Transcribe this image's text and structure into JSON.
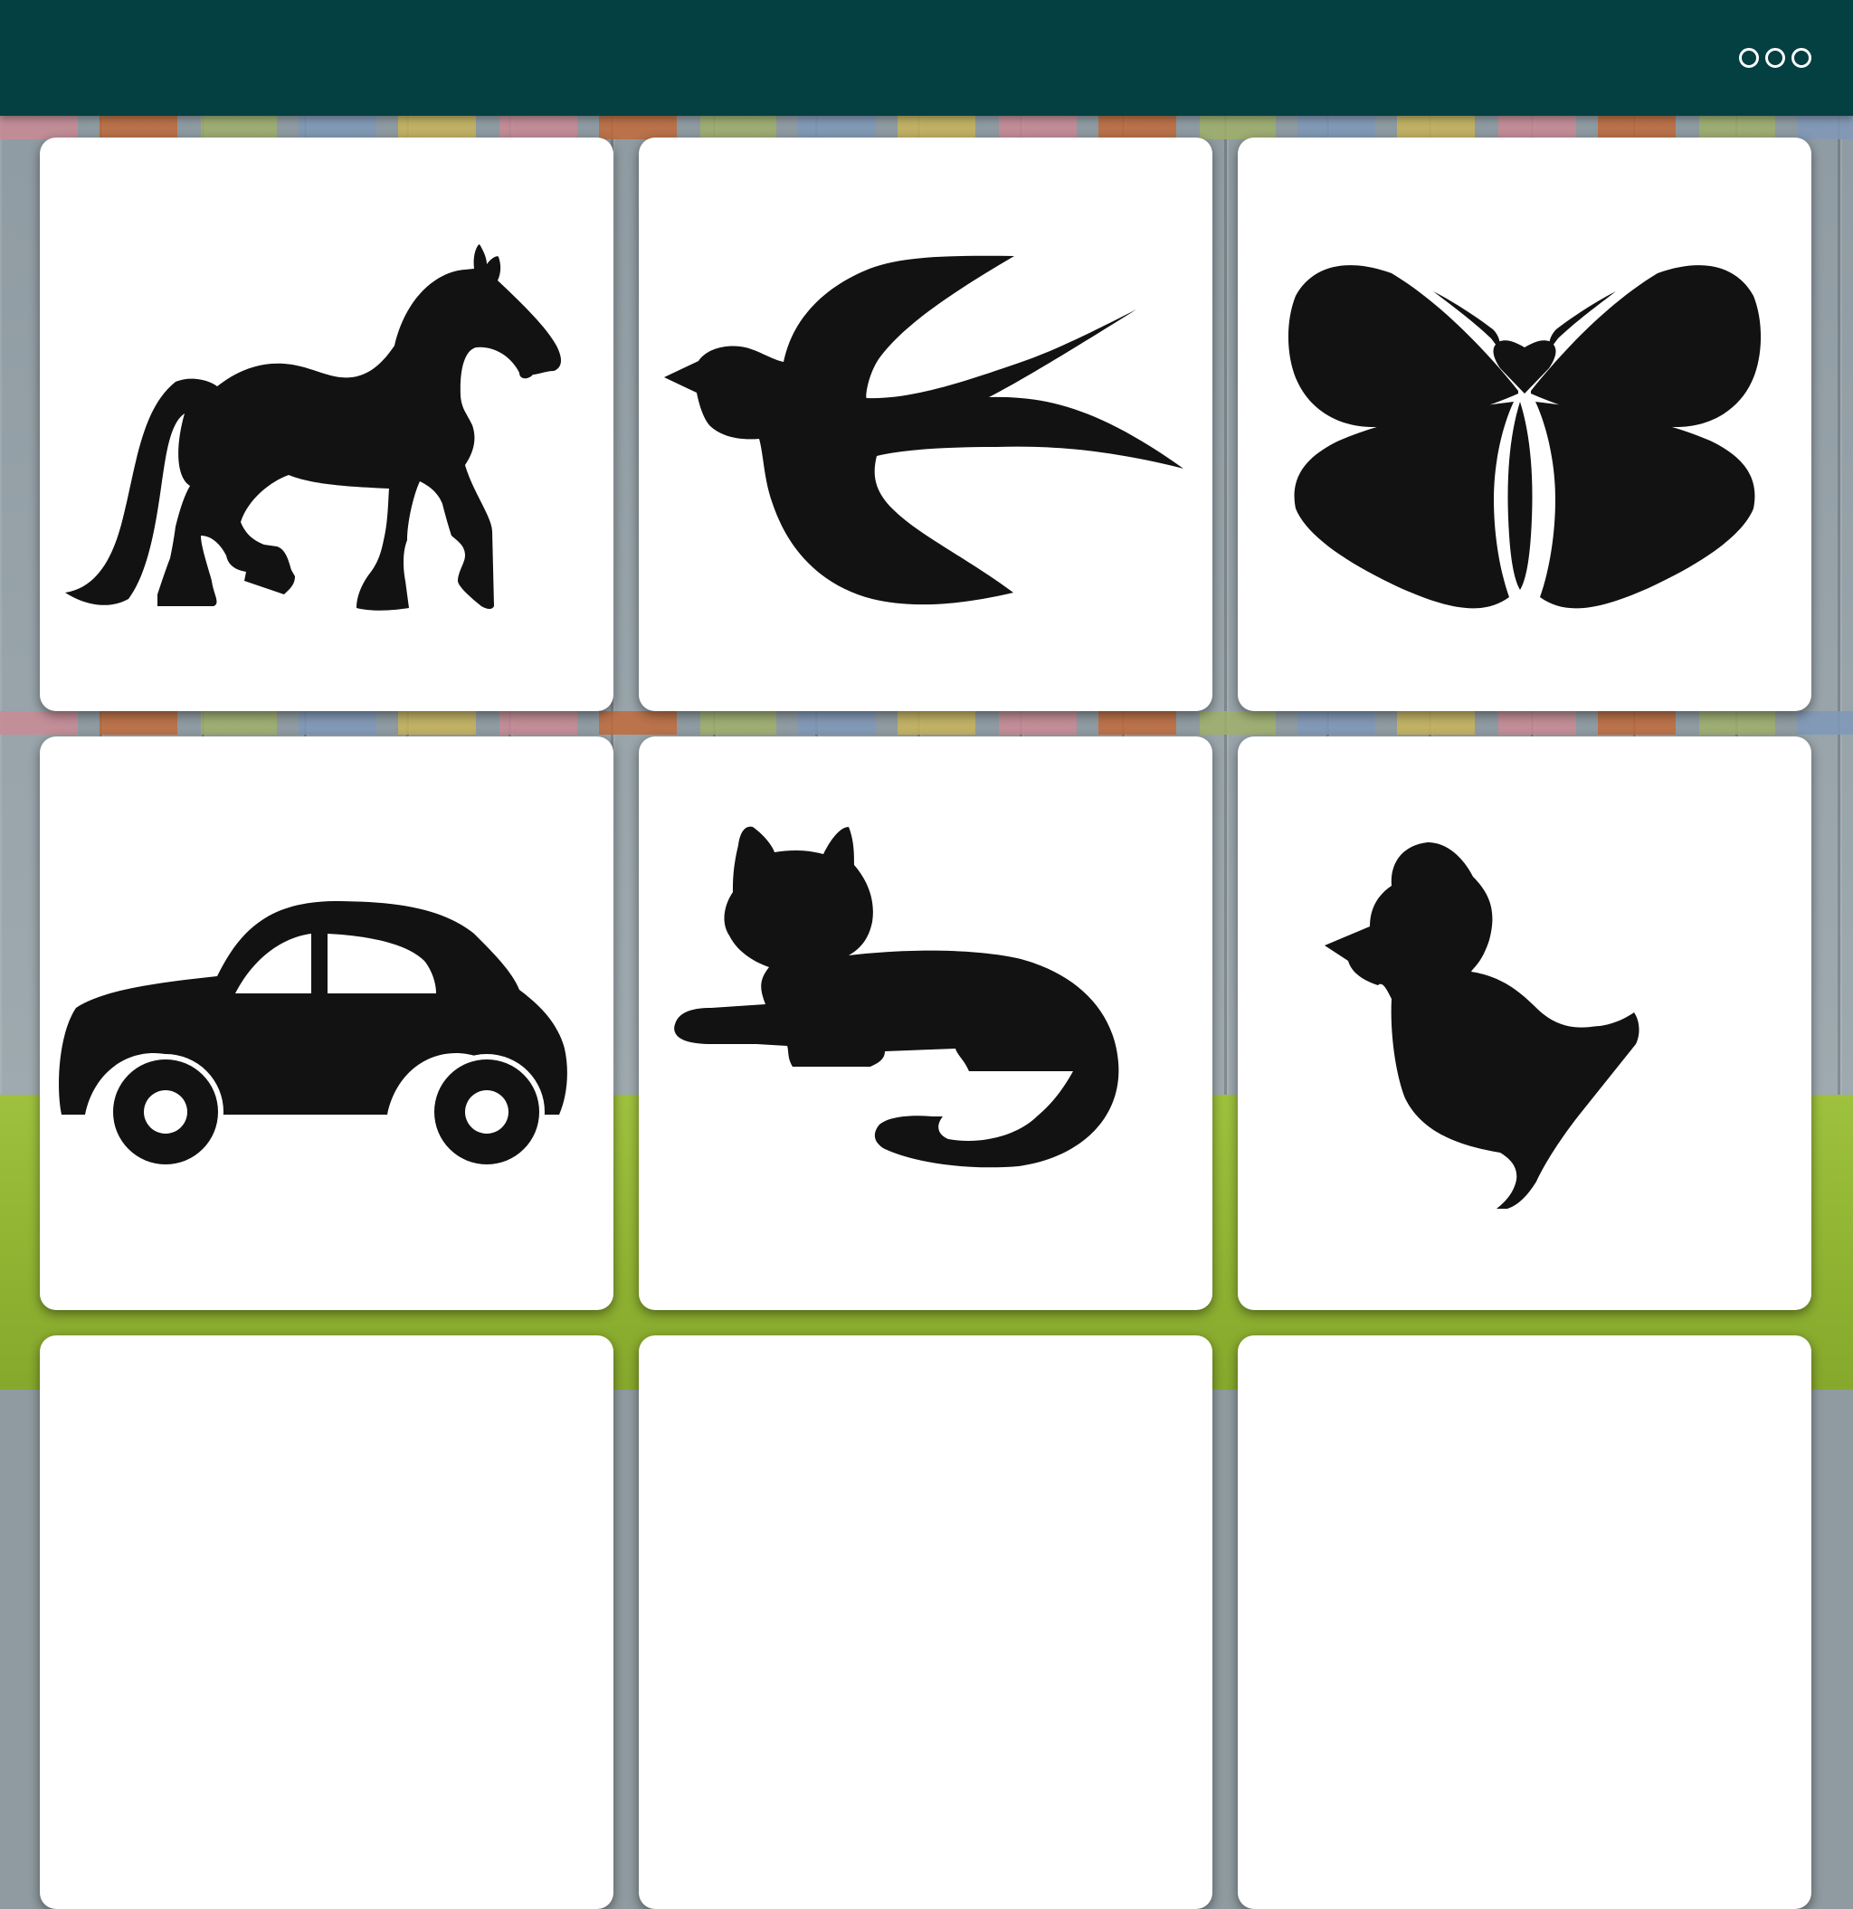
{
  "app": {
    "menu_icon": "more-options-icon",
    "colors": {
      "topbar": "#043f41",
      "card": "#ffffff",
      "silhouette": "#121212",
      "grass": "#9ec13e"
    }
  },
  "cards": [
    {
      "name": "horse",
      "icon": "horse-silhouette-icon"
    },
    {
      "name": "swallow",
      "icon": "swallow-bird-silhouette-icon"
    },
    {
      "name": "butterfly",
      "icon": "butterfly-silhouette-icon"
    },
    {
      "name": "car",
      "icon": "car-silhouette-icon"
    },
    {
      "name": "cat",
      "icon": "cat-silhouette-icon"
    },
    {
      "name": "chick",
      "icon": "chick-silhouette-icon"
    },
    {
      "name": "card-7",
      "icon": ""
    },
    {
      "name": "card-8",
      "icon": ""
    },
    {
      "name": "card-9",
      "icon": ""
    }
  ]
}
